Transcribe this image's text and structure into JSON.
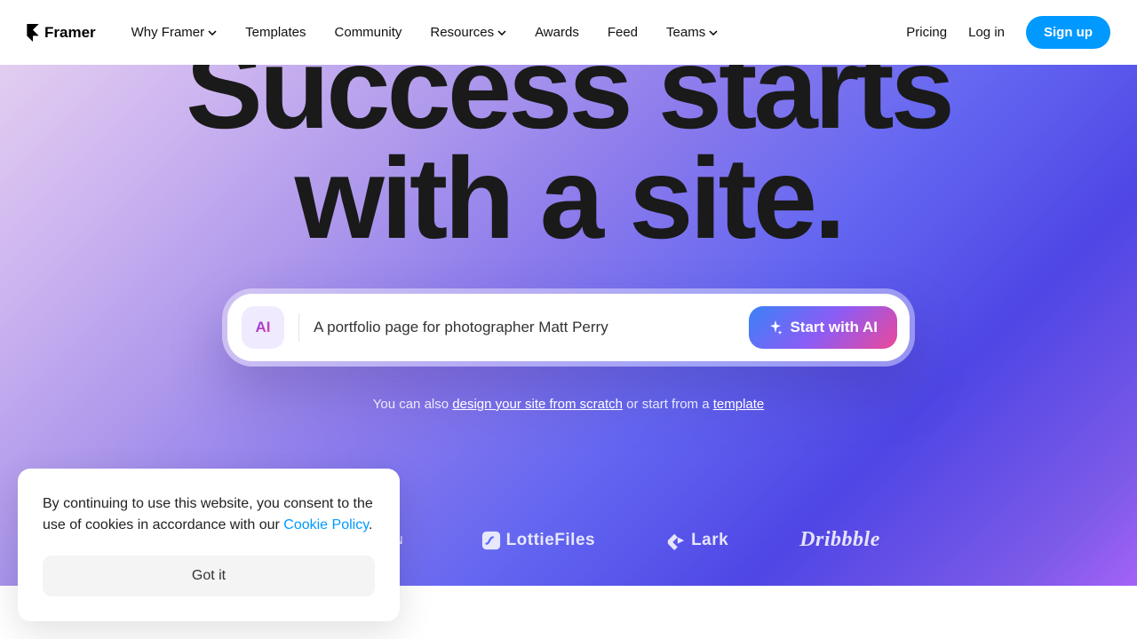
{
  "nav": {
    "logo": "Framer",
    "items_left": [
      {
        "label": "Why Framer",
        "dropdown": true
      },
      {
        "label": "Templates",
        "dropdown": false
      },
      {
        "label": "Community",
        "dropdown": false
      },
      {
        "label": "Resources",
        "dropdown": true
      },
      {
        "label": "Awards",
        "dropdown": false
      },
      {
        "label": "Feed",
        "dropdown": false
      },
      {
        "label": "Teams",
        "dropdown": true
      }
    ],
    "pricing": "Pricing",
    "login": "Log in",
    "signup": "Sign up"
  },
  "hero": {
    "headline_line1": "Success starts",
    "headline_line2": "with a site."
  },
  "ai": {
    "icon_label": "AI",
    "input_value": "A portfolio page for photographer Matt Perry",
    "button_label": "Start with AI"
  },
  "subtext": {
    "prefix": "You can also ",
    "link1": "design your site from scratch",
    "mid": " or start from a ",
    "link2": "template"
  },
  "brands": {
    "superhuman": "SUPERHUMAN",
    "lottiefiles": "LottieFiles",
    "lark": "Lark",
    "dribbble": "Dribbble"
  },
  "cookie": {
    "text_part1": "By continuing to use this website, you consent to the use of cookies in accordance with our ",
    "link": "Cookie Policy",
    "text_part2": ".",
    "button": "Got it"
  }
}
